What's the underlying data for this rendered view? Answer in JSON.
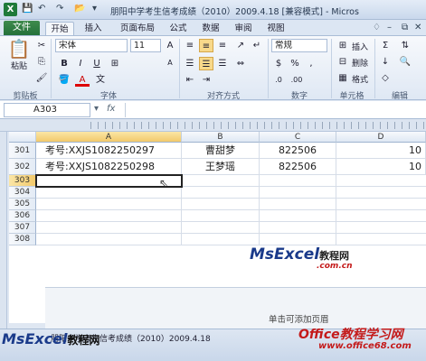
{
  "window": {
    "title": "朋阳中学考生信考成绩（2010）2009.4.18 [兼容模式] - Micros",
    "app_icon": "X",
    "minimize": "–",
    "maximize": "□",
    "close": "✕"
  },
  "tabs": {
    "file": "文件",
    "items": [
      "开始",
      "插入",
      "页面布局",
      "公式",
      "数据",
      "审阅",
      "视图"
    ]
  },
  "ribbon": {
    "clipboard": {
      "paste": "粘贴",
      "label": "剪贴板"
    },
    "font": {
      "name": "宋体",
      "size": "11",
      "bold": "B",
      "italic": "I",
      "underline": "U",
      "grow": "A",
      "shrink": "A",
      "color_a": "A",
      "label": "字体"
    },
    "alignment": {
      "label": "对齐方式"
    },
    "number": {
      "format": "常规",
      "percent": "%",
      "comma": ",",
      "currency": "$",
      "label": "数字"
    },
    "styles": {
      "label": "样式"
    },
    "cells": {
      "insert": "插入",
      "delete": "删除",
      "format": "格式",
      "label": "单元格"
    },
    "editing": {
      "sum": "Σ",
      "fill": "↓",
      "clear": "◇",
      "label": "编辑"
    }
  },
  "formula_bar": {
    "name_box": "A303"
  },
  "sheet": {
    "columns": [
      "A",
      "B",
      "C",
      "D"
    ],
    "rows": [
      {
        "num": "301",
        "a": "考号:XXJS1082250297",
        "b": "曹甜梦",
        "c": "822506",
        "d": "10"
      },
      {
        "num": "302",
        "a": "考号:XXJS1082250298",
        "b": "王梦瑶",
        "c": "822506",
        "d": "10"
      },
      {
        "num": "303"
      },
      {
        "num": "304"
      },
      {
        "num": "305"
      },
      {
        "num": "306"
      },
      {
        "num": "307"
      },
      {
        "num": "308"
      }
    ]
  },
  "watermark": {
    "brand": "MsExcel",
    "cn": "教程网",
    "domain": ".com.cn"
  },
  "footer": {
    "hint": "单击可添加页眉"
  },
  "status": {
    "sheet_tab": "朋阳中学考生信考成绩（2010）2009.4.18",
    "bottom_logo": "MsExcel",
    "bottom_logo_cn": "教程网",
    "site_name": "Office教程学习网",
    "site_url": "www.office68.com"
  }
}
